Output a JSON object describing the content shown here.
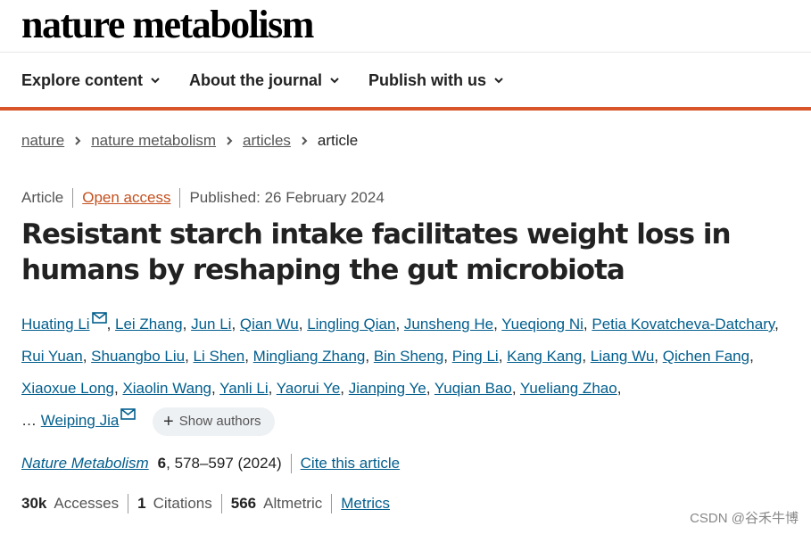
{
  "header": {
    "logo": "nature metabolism"
  },
  "nav": [
    {
      "label": "Explore content"
    },
    {
      "label": "About the journal"
    },
    {
      "label": "Publish with us"
    }
  ],
  "breadcrumb": [
    "nature",
    "nature metabolism",
    "articles",
    "article"
  ],
  "meta": {
    "type": "Article",
    "access": "Open access",
    "published": "Published: 26 February 2024"
  },
  "title": "Resistant starch intake facilitates weight loss in humans by reshaping the gut microbiota",
  "authors": [
    "Huating Li",
    "Lei Zhang",
    "Jun Li",
    "Qian Wu",
    "Lingling Qian",
    "Junsheng He",
    "Yueqiong Ni",
    "Petia Kovatcheva-Datchary",
    "Rui Yuan",
    "Shuangbo Liu",
    "Li Shen",
    "Mingliang Zhang",
    "Bin Sheng",
    "Ping Li",
    "Kang Kang",
    "Liang Wu",
    "Qichen Fang",
    "Xiaoxue Long",
    "Xiaolin Wang",
    "Yanli Li",
    "Yaorui Ye",
    "Jianping Ye",
    "Yuqian Bao",
    "Yueliang Zhao",
    "Weiping Jia"
  ],
  "ellipsis": "…",
  "show_authors": "Show authors",
  "citation": {
    "journal": "Nature Metabolism",
    "volume": "6",
    "pages": ", 578–597 (2024)",
    "cite_link": "Cite this article"
  },
  "metrics": {
    "accesses_value": "30k",
    "accesses_label": "Accesses",
    "citations_value": "1",
    "citations_label": "Citations",
    "altmetric_value": "566",
    "altmetric_label": "Altmetric",
    "metrics_link": "Metrics"
  },
  "watermark": "CSDN @谷禾牛博"
}
